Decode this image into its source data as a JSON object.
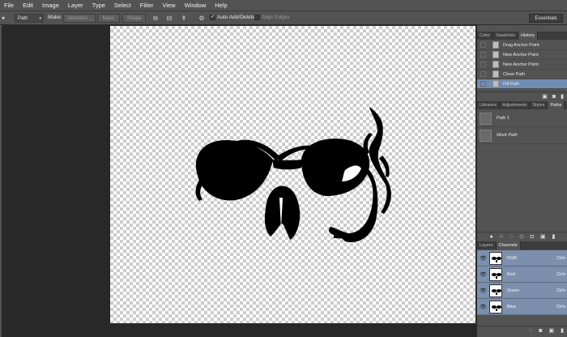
{
  "menu": [
    "File",
    "Edit",
    "Image",
    "Layer",
    "Type",
    "Select",
    "Filter",
    "View",
    "Window",
    "Help"
  ],
  "options": {
    "mode": "Path",
    "make_label": "Make:",
    "selection_btn": "Selection...",
    "mask_btn": "Mask",
    "shape_btn": "Shape",
    "auto_add_delete": "Auto Add/Delete",
    "align_edges": "Align Edges",
    "workspace": "Essentials"
  },
  "history_panel": {
    "tabs": [
      "Color",
      "Swatches",
      "History"
    ],
    "items": [
      "Drag Anchor Point",
      "New Anchor Point",
      "New Anchor Point",
      "Close Path",
      "Fill Path"
    ]
  },
  "paths_panel": {
    "tabs": [
      "Libraries",
      "Adjustments",
      "Styles",
      "Paths"
    ],
    "items": [
      "Path 1",
      "Work Path"
    ]
  },
  "channels_panel": {
    "tabs": [
      "Layers",
      "Channels"
    ],
    "items": [
      {
        "name": "RGB",
        "shortcut": "Ctrl+"
      },
      {
        "name": "Red",
        "shortcut": "Ctrl+"
      },
      {
        "name": "Green",
        "shortcut": "Ctrl+"
      },
      {
        "name": "Blue",
        "shortcut": "Ctrl+"
      }
    ]
  },
  "colors": {
    "ui_bg": "#535353",
    "dark_bg": "#282828",
    "selection": "#7c90ad"
  }
}
